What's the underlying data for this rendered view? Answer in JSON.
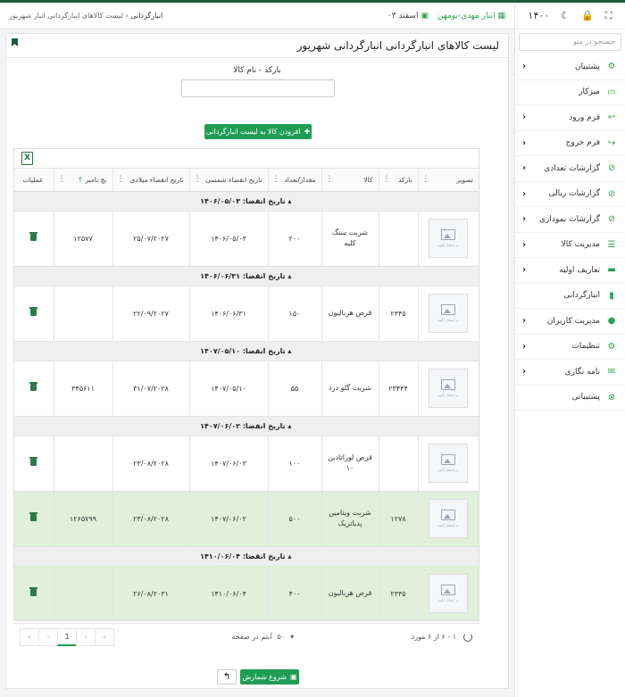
{
  "header": {
    "breadcrumb_root": "انبارگردانی",
    "breadcrumb_sep": "‹",
    "breadcrumb_page": "لیست کالاهای انبارگردانی انبار شهریور",
    "warehouse": "انبار مهدی-بومهن",
    "month": "اسفند ۰۳"
  },
  "sidebar": {
    "year": "۱۴۰۰",
    "search_placeholder": "جستجو در منو",
    "items": [
      {
        "label": "پشتیبان",
        "icon": "cogs-icon",
        "chevron": "‹"
      },
      {
        "label": "میزکار",
        "icon": "desktop-icon",
        "chevron": ""
      },
      {
        "label": "فرم ورود",
        "icon": "reply-icon",
        "chevron": "‹"
      },
      {
        "label": "فرم خروج",
        "icon": "share-icon",
        "chevron": "‹"
      },
      {
        "label": "گزارشات تعدادی",
        "icon": "ban-icon",
        "chevron": "‹"
      },
      {
        "label": "گزارشات ریالی",
        "icon": "ban-icon",
        "chevron": "‹"
      },
      {
        "label": "گزارشات نموداری",
        "icon": "ban-icon",
        "chevron": "‹"
      },
      {
        "label": "مدیریت کالا",
        "icon": "list-icon",
        "chevron": "‹"
      },
      {
        "label": "تعاریف اولیه",
        "icon": "box-icon",
        "chevron": "‹"
      },
      {
        "label": "انبارگردانی",
        "icon": "file-icon",
        "chevron": ""
      },
      {
        "label": "مدیریت کاربران",
        "icon": "user-icon",
        "chevron": "‹"
      },
      {
        "label": "تنظیمات",
        "icon": "cogs-icon",
        "chevron": "‹"
      },
      {
        "label": "نامه نگاری",
        "icon": "envelope-icon",
        "chevron": "‹"
      },
      {
        "label": "پشتیبانی",
        "icon": "times-circle-icon",
        "chevron": ""
      }
    ]
  },
  "page": {
    "title": "لیست کالاهای انبارگردانی انبارگردانی شهریور",
    "field_label": "بارکد - نام کالا",
    "add_button": "افزودن کالا به لیست انبارگردانی",
    "start_button": "شروع شمارش"
  },
  "table": {
    "columns": [
      "تصویر",
      "بارکد",
      "کالا",
      "مقدار/تعداد",
      "تاریخ انقضاء شمسی",
      "تاریخ انقضاء میلادی",
      "بچ نامبر",
      "عملیات"
    ],
    "thumb_caption": "در انتظار آپلود",
    "groups": [
      {
        "label": "▴ تاریخ انقضا: ۱۴۰۶/۰۵/۰۳",
        "row": {
          "barcode": "",
          "name": "شربت سنگ کلیه",
          "qty": "۲۰۰",
          "shamsi": "۱۴۰۶/۰۵/۰۳",
          "miladi": "۲۵/۰۷/۲۰۲۷",
          "batch": "۱۲۵۷۷",
          "selected": false
        }
      },
      {
        "label": "▴ تاریخ انقضا: ۱۴۰۶/۰۶/۳۱",
        "row": {
          "barcode": "۲۳۴۵",
          "name": "قرص هربالیون",
          "qty": "۱۵۰",
          "shamsi": "۱۴۰۶/۰۶/۳۱",
          "miladi": "۲۲/۰۹/۲۰۲۷",
          "batch": "",
          "selected": false
        }
      },
      {
        "label": "▴ تاریخ انقضا: ۱۴۰۷/۰۵/۱۰",
        "row": {
          "barcode": "۲۳۴۴۴",
          "name": "شربت گلو درد",
          "qty": "۵۵",
          "shamsi": "۱۴۰۷/۰۵/۱۰",
          "miladi": "۳۱/۰۷/۲۰۲۸",
          "batch": "۳۴۵۶۱۱",
          "selected": false
        }
      },
      {
        "label": "▴ تاریخ انقضا: ۱۴۰۷/۰۶/۰۲",
        "row": {
          "barcode": "",
          "name": "قرص لوراتادین ۱۰",
          "qty": "۱۰۰",
          "shamsi": "۱۴۰۷/۰۶/۰۳",
          "miladi": "۲۳/۰۸/۲۰۲۸",
          "batch": "",
          "selected": false
        },
        "extra": {
          "barcode": "۱۲۷۸",
          "name": "شربت ویتامین پدیاتریک",
          "qty": "۵۰۰",
          "shamsi": "۱۴۰۷/۰۶/۰۲",
          "miladi": "۲۳/۰۸/۲۰۲۸",
          "batch": "۱۲۶۵۷۹۹",
          "selected": true
        }
      },
      {
        "label": "▴ تاریخ انقضا: ۱۴۱۰/۰۶/۰۴",
        "row": {
          "barcode": "۲۳۴۵",
          "name": "قرص هربالیون",
          "qty": "۴۰۰",
          "shamsi": "۱۴۱۰/۰۶/۰۴",
          "miladi": "۲۶/۰۸/۲۰۳۱",
          "batch": "",
          "selected": true
        }
      }
    ]
  },
  "pager": {
    "range": "۱ - ۶ از ۶ مورد",
    "page_size": "۵۰",
    "page_size_label": "آیتم در صفحه",
    "current": "1",
    "first": "«",
    "prev": "‹",
    "next": "›",
    "last": "»"
  }
}
